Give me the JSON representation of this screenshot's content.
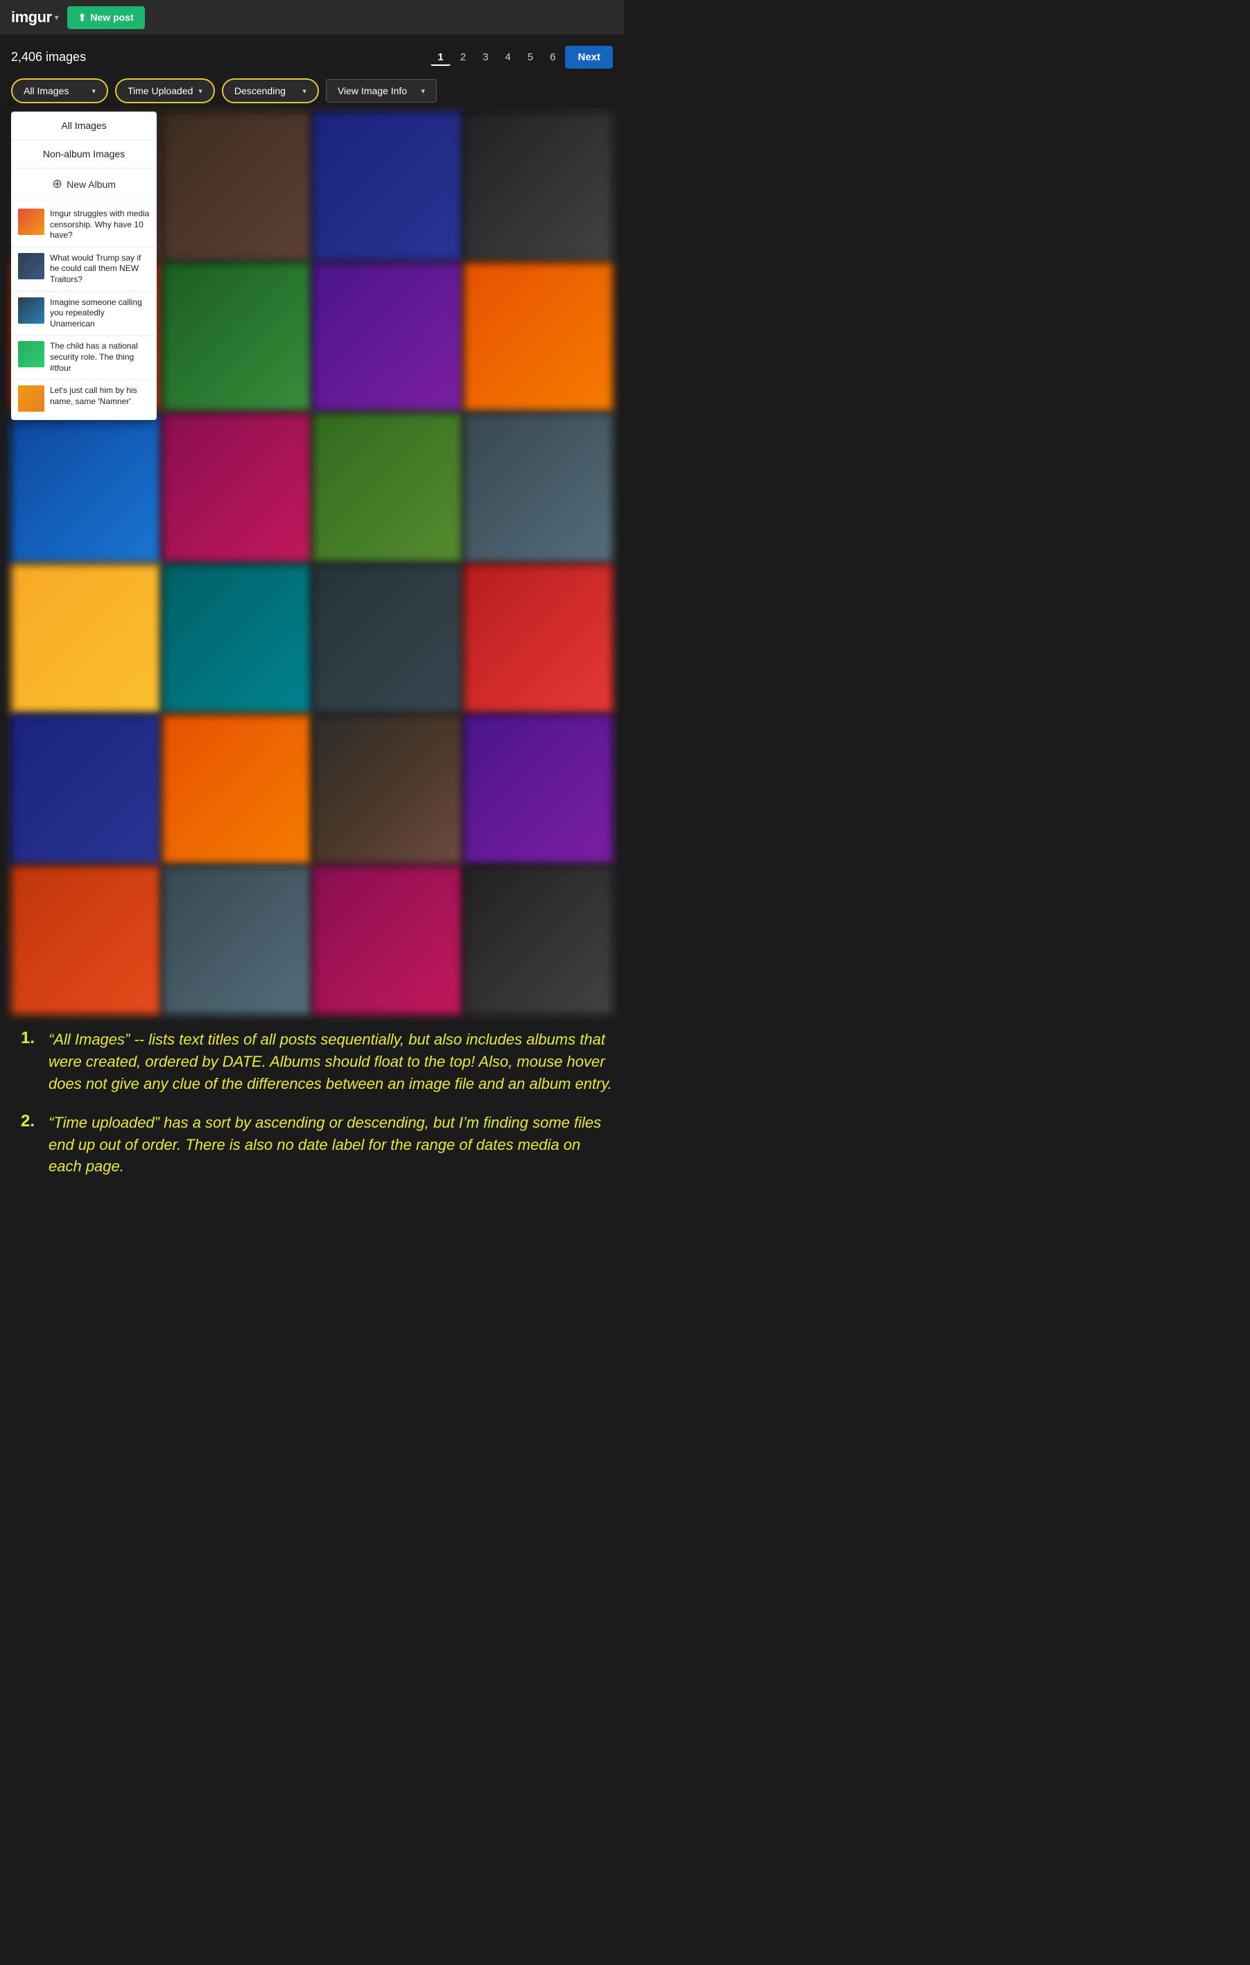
{
  "navbar": {
    "logo": "imgur",
    "logo_chevron": "▾",
    "new_post_label": "New post"
  },
  "header": {
    "image_count": "2,406 images"
  },
  "pagination": {
    "pages": [
      "1",
      "2",
      "3",
      "4",
      "5",
      "6"
    ],
    "active_page": "1",
    "next_label": "Next"
  },
  "filters": {
    "filter1_label": "All Images",
    "filter2_label": "Time Uploaded",
    "filter3_label": "Descending",
    "filter4_label": "View Image Info"
  },
  "dropdown": {
    "item1": "All Images",
    "item2": "Non-album Images",
    "item3_label": "New Album",
    "albums": [
      {
        "id": 1,
        "thumb_class": "t1",
        "title": "Imgur struggles with media censorship. Why have 10 have?"
      },
      {
        "id": 2,
        "thumb_class": "t2",
        "title": "What would Trump say if he could call them NEW Traitors?"
      },
      {
        "id": 3,
        "thumb_class": "t3",
        "title": "Imagine someone calling you repeatedly Unamerican"
      },
      {
        "id": 4,
        "thumb_class": "t4",
        "title": "The child has a national security role. The thing #tfour"
      },
      {
        "id": 5,
        "thumb_class": "t5",
        "title": "Let's just call him by his name, same 'Namner'"
      }
    ]
  },
  "annotations": [
    {
      "number": "1.",
      "text": "“All Images” -- lists text titles of all posts sequentially, but also includes albums that were created, ordered by DATE. Albums should float to the top! Also, mouse hover does not give any clue of the differences between an image file and an album entry."
    },
    {
      "number": "2.",
      "text": "“Time uploaded” has a sort by ascending or descending, but I’m finding some files end up out of order. There is also no date label for the range of dates media on each page."
    }
  ]
}
